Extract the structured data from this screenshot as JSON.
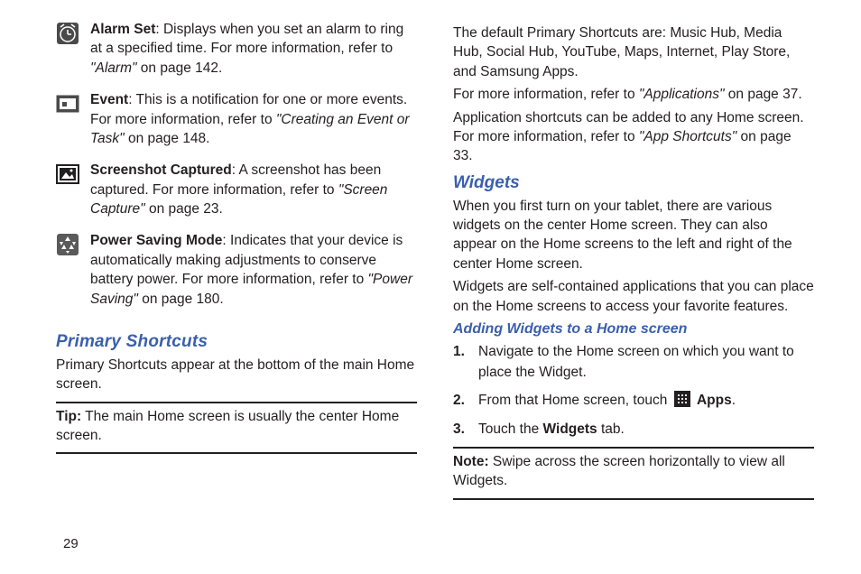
{
  "pageNumber": "29",
  "leftColumn": {
    "icons": [
      {
        "iconName": "alarm-clock-icon",
        "title": "Alarm Set",
        "text": ": Displays when you set an alarm to ring at a specified time. For more information, refer to ",
        "ref": "\"Alarm\"",
        "suffix": "  on page 142."
      },
      {
        "iconName": "calendar-event-icon",
        "title": "Event",
        "text": ": This is a notification for one or more events. For more information, refer to ",
        "ref": "\"Creating an Event or Task\"",
        "suffix": "  on page 148."
      },
      {
        "iconName": "screenshot-icon",
        "title": "Screenshot Captured",
        "text": ": A screenshot has been captured. For more information, refer to ",
        "ref": "\"Screen Capture\"",
        "suffix": "  on page 23."
      },
      {
        "iconName": "recycle-icon",
        "title": "Power Saving Mode",
        "text": ": Indicates that your device is automatically making adjustments to conserve battery power. For more information, refer to ",
        "ref": "\"Power Saving\"",
        "suffix": "  on page 180."
      }
    ],
    "primaryShortcuts": {
      "heading": "Primary Shortcuts",
      "body": "Primary Shortcuts appear at the bottom of the main Home screen.",
      "tipLabel": "Tip:",
      "tipText": " The main Home screen is usually the center Home screen."
    }
  },
  "rightColumn": {
    "para1": "The default Primary Shortcuts are: Music Hub, Media Hub, Social Hub, YouTube, Maps, Internet, Play Store, and Samsung Apps.",
    "para2_pre": "For more information, refer to ",
    "para2_ref": "\"Applications\"",
    "para2_post": "  on page 37.",
    "para3_pre": "Application shortcuts can be added to any Home screen. For more information, refer to ",
    "para3_ref": "\"App Shortcuts\"",
    "para3_post": "  on page 33.",
    "widgets": {
      "heading": "Widgets",
      "body1": "When you first turn on your tablet, there are various widgets on the center Home screen. They can also appear on the Home screens to the left and right of the center Home screen.",
      "body2": "Widgets are self-contained applications that you can place on the Home screens to access your favorite features."
    },
    "adding": {
      "heading": "Adding Widgets to a Home screen",
      "steps": [
        {
          "num": "1.",
          "text": "Navigate to the Home screen on which you want to place the Widget."
        },
        {
          "num": "2.",
          "pre": "From that Home screen, touch ",
          "appsLabel": "Apps",
          "post": "."
        },
        {
          "num": "3.",
          "pre": "Touch the ",
          "bold": "Widgets",
          "post": " tab."
        }
      ]
    },
    "noteLabel": "Note:",
    "noteText": " Swipe across the screen horizontally to view all Widgets."
  }
}
